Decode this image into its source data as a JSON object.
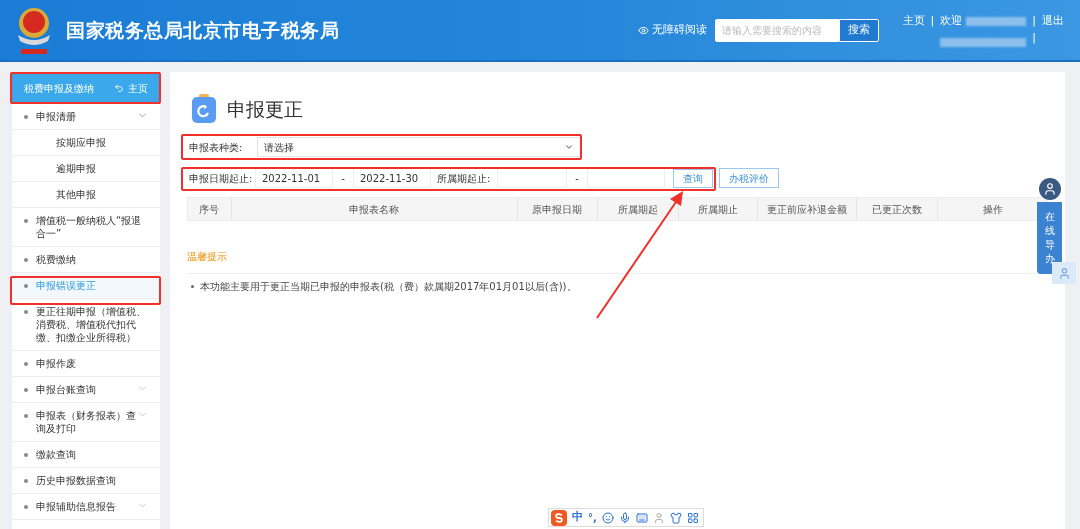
{
  "header": {
    "title": "国家税务总局北京市电子税务局",
    "accessibility_label": "无障碍阅读",
    "search": {
      "placeholder": "请输入需要搜索的内容"
    },
    "search_button": "搜索",
    "home_link": "主页",
    "separator": "|",
    "welcome": "欢迎",
    "logout": "退出"
  },
  "sidebar": {
    "title": "税费申报及缴纳",
    "home_link": "主页",
    "items": [
      {
        "label": "申报清册",
        "kind": "group",
        "selected": false,
        "expanded": true,
        "children": [
          {
            "label": "按期应申报",
            "selected": false
          },
          {
            "label": "逾期申报",
            "selected": false
          },
          {
            "label": "其他申报",
            "selected": false
          }
        ]
      },
      {
        "label": "增值税一般纳税人“报退合一”",
        "selected": false
      },
      {
        "label": "税费缴纳",
        "selected": false
      },
      {
        "label": "申报错误更正",
        "selected": true
      },
      {
        "label": "更正往期申报（增值税、消费税、增值税代扣代缴、扣缴企业所得税）",
        "selected": false
      },
      {
        "label": "申报作废",
        "selected": false
      },
      {
        "label": "申报台账查询",
        "kind": "group",
        "selected": false,
        "expanded": false
      },
      {
        "label": "申报表（财务报表）查询及打印",
        "kind": "group",
        "selected": false,
        "expanded": false
      },
      {
        "label": "缴款查询",
        "selected": false
      },
      {
        "label": "历史申报数据查询",
        "selected": false
      },
      {
        "label": "申报辅助信息报告",
        "kind": "group",
        "selected": false,
        "expanded": false
      }
    ]
  },
  "main": {
    "title": "申报更正",
    "form_type": {
      "label": "申报表种类:",
      "value": "请选择"
    },
    "date_range": {
      "label": "申报日期起止:",
      "from": "2022-11-01",
      "dash": "-",
      "to": "2022-11-30"
    },
    "period_range": {
      "label": "所属期起止:",
      "dash": "-"
    },
    "query_button": "查询",
    "rating_button": "办税评价",
    "table": {
      "columns": [
        "序号",
        "申报表名称",
        "原申报日期",
        "所属期起",
        "所属期止",
        "更正前应补退金额",
        "已更正次数",
        "操作"
      ]
    },
    "tips": {
      "title": "温馨提示",
      "items": [
        "本功能主要用于更正当期已申报的申报表(税（费）款属期2017年01月01以后(含))。"
      ]
    }
  },
  "guide_widget": {
    "label": "在线导办"
  },
  "ime_toolbar": {
    "mode": "中",
    "punctuation": "°,"
  }
}
